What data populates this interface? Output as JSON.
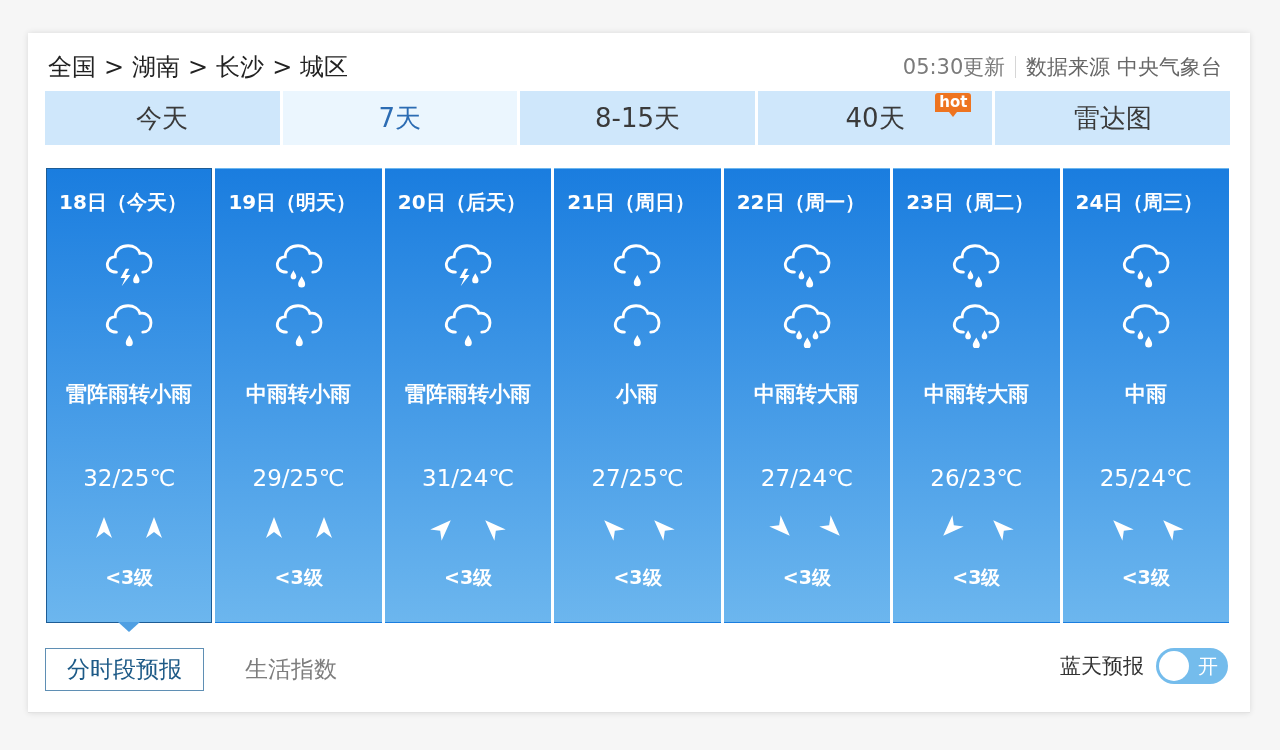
{
  "breadcrumb": {
    "items": [
      "全国",
      "湖南",
      "长沙",
      "城区"
    ],
    "separator": ">"
  },
  "update_time": "05:30更新",
  "source": "数据来源 中央气象台",
  "tabs": [
    {
      "label": "今天",
      "selected": false
    },
    {
      "label": "7天",
      "selected": true
    },
    {
      "label": "8-15天",
      "selected": false
    },
    {
      "label": "40天",
      "selected": false,
      "badge": "hot"
    },
    {
      "label": "雷达图",
      "selected": false
    }
  ],
  "days": [
    {
      "date": "18日（今天）",
      "selected": true,
      "icons": [
        {
          "kind": "thunder_rain"
        },
        {
          "kind": "light_rain"
        }
      ],
      "description": "雷阵雨转小雨",
      "temperature": "32/25℃",
      "wind_arrows": [
        {
          "kind": "north"
        },
        {
          "kind": "north"
        }
      ],
      "wind_level": "<3级"
    },
    {
      "date": "19日（明天）",
      "selected": false,
      "icons": [
        {
          "kind": "moderate_rain"
        },
        {
          "kind": "light_rain"
        }
      ],
      "description": "中雨转小雨",
      "temperature": "29/25℃",
      "wind_arrows": [
        {
          "kind": "north"
        },
        {
          "kind": "north"
        }
      ],
      "wind_level": "<3级"
    },
    {
      "date": "20日（后天）",
      "selected": false,
      "icons": [
        {
          "kind": "thunder_rain"
        },
        {
          "kind": "light_rain"
        }
      ],
      "description": "雷阵雨转小雨",
      "temperature": "31/24℃",
      "wind_arrows": [
        {
          "kind": "northeast"
        },
        {
          "kind": "northwest"
        }
      ],
      "wind_level": "<3级"
    },
    {
      "date": "21日（周日）",
      "selected": false,
      "icons": [
        {
          "kind": "light_rain"
        },
        {
          "kind": "light_rain"
        }
      ],
      "description": "小雨",
      "temperature": "27/25℃",
      "wind_arrows": [
        {
          "kind": "northwest"
        },
        {
          "kind": "northwest"
        }
      ],
      "wind_level": "<3级"
    },
    {
      "date": "22日（周一）",
      "selected": false,
      "icons": [
        {
          "kind": "moderate_rain"
        },
        {
          "kind": "heavy_rain"
        }
      ],
      "description": "中雨转大雨",
      "temperature": "27/24℃",
      "wind_arrows": [
        {
          "kind": "southeast"
        },
        {
          "kind": "southeast"
        }
      ],
      "wind_level": "<3级"
    },
    {
      "date": "23日（周二）",
      "selected": false,
      "icons": [
        {
          "kind": "moderate_rain"
        },
        {
          "kind": "heavy_rain"
        }
      ],
      "description": "中雨转大雨",
      "temperature": "26/23℃",
      "wind_arrows": [
        {
          "kind": "southwest"
        },
        {
          "kind": "northwest"
        }
      ],
      "wind_level": "<3级"
    },
    {
      "date": "24日（周三）",
      "selected": false,
      "icons": [
        {
          "kind": "moderate_rain"
        },
        {
          "kind": "moderate_rain"
        }
      ],
      "description": "中雨",
      "temperature": "25/24℃",
      "wind_arrows": [
        {
          "kind": "northwest"
        },
        {
          "kind": "northwest"
        }
      ],
      "wind_level": "<3级"
    }
  ],
  "bottom_tabs": [
    {
      "label": "分时段预报",
      "selected": true
    },
    {
      "label": "生活指数",
      "selected": false
    }
  ],
  "blue_sky_forecast": {
    "label": "蓝天预报",
    "switch_text": "开",
    "on": false
  }
}
